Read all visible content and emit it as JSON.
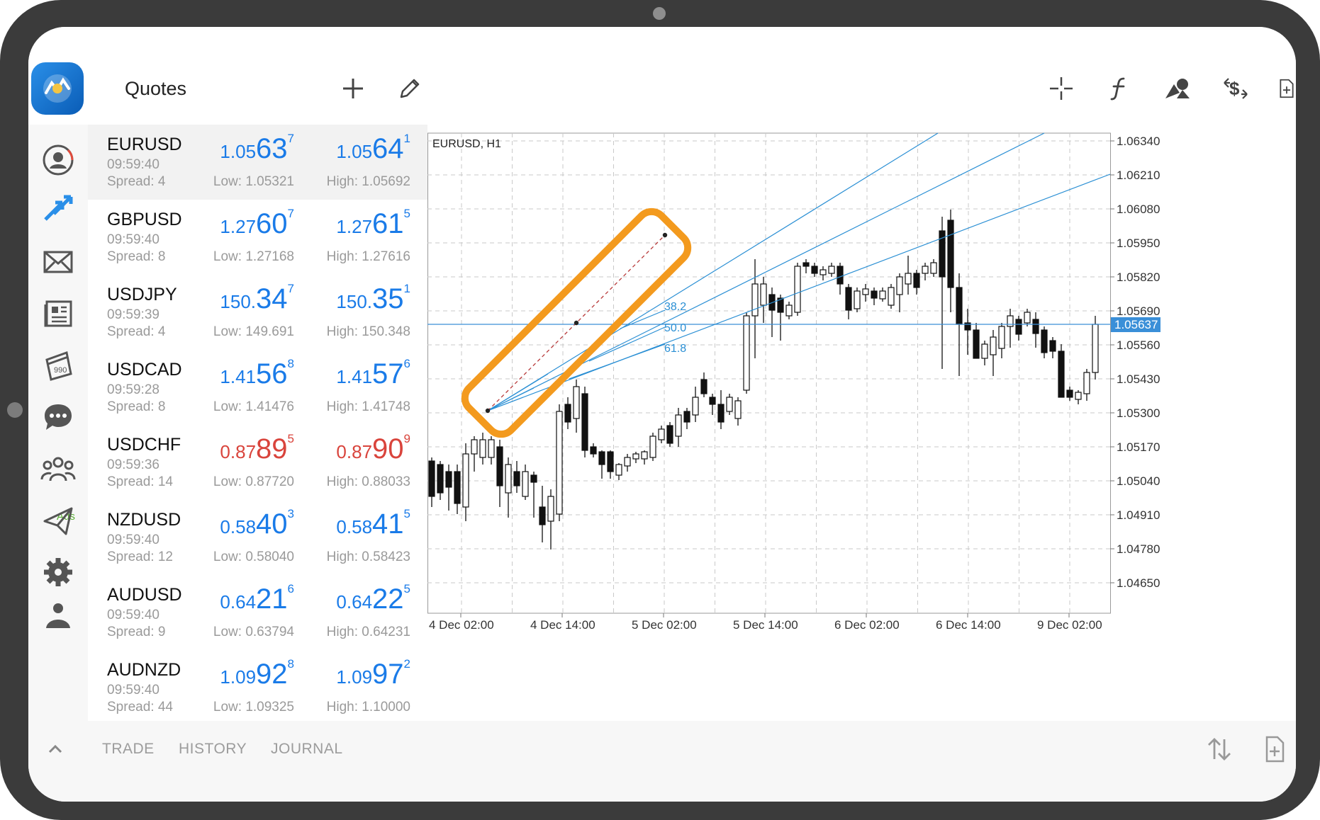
{
  "header": {
    "title": "Quotes",
    "icons": [
      "add-icon",
      "edit-icon",
      "crosshair-icon",
      "function-icon",
      "objects-icon",
      "trade-dollar-icon",
      "new-document-icon"
    ]
  },
  "sidebar": {
    "items": [
      "account",
      "trade",
      "mail",
      "news",
      "market-ads",
      "chat",
      "community",
      "telegram",
      "settings",
      "traders"
    ],
    "ads_label": "Ads"
  },
  "quotes": [
    {
      "symbol": "EURUSD",
      "time": "09:59:40",
      "spread": "Spread: 4",
      "bid": {
        "pre": "1.05",
        "big": "63",
        "sup": "7"
      },
      "ask": {
        "pre": "1.05",
        "big": "64",
        "sup": "1"
      },
      "low": "Low: 1.05321",
      "high": "High: 1.05692",
      "dir": "up"
    },
    {
      "symbol": "GBPUSD",
      "time": "09:59:40",
      "spread": "Spread: 8",
      "bid": {
        "pre": "1.27",
        "big": "60",
        "sup": "7"
      },
      "ask": {
        "pre": "1.27",
        "big": "61",
        "sup": "5"
      },
      "low": "Low: 1.27168",
      "high": "High: 1.27616",
      "dir": "up"
    },
    {
      "symbol": "USDJPY",
      "time": "09:59:39",
      "spread": "Spread: 4",
      "bid": {
        "pre": "150.",
        "big": "34",
        "sup": "7"
      },
      "ask": {
        "pre": "150.",
        "big": "35",
        "sup": "1"
      },
      "low": "Low: 149.691",
      "high": "High: 150.348",
      "dir": "up"
    },
    {
      "symbol": "USDCAD",
      "time": "09:59:28",
      "spread": "Spread: 8",
      "bid": {
        "pre": "1.41",
        "big": "56",
        "sup": "8"
      },
      "ask": {
        "pre": "1.41",
        "big": "57",
        "sup": "6"
      },
      "low": "Low: 1.41476",
      "high": "High: 1.41748",
      "dir": "up"
    },
    {
      "symbol": "USDCHF",
      "time": "09:59:36",
      "spread": "Spread: 14",
      "bid": {
        "pre": "0.87",
        "big": "89",
        "sup": "5"
      },
      "ask": {
        "pre": "0.87",
        "big": "90",
        "sup": "9"
      },
      "low": "Low: 0.87720",
      "high": "High: 0.88033",
      "dir": "down"
    },
    {
      "symbol": "NZDUSD",
      "time": "09:59:40",
      "spread": "Spread: 12",
      "bid": {
        "pre": "0.58",
        "big": "40",
        "sup": "3"
      },
      "ask": {
        "pre": "0.58",
        "big": "41",
        "sup": "5"
      },
      "low": "Low: 0.58040",
      "high": "High: 0.58423",
      "dir": "up"
    },
    {
      "symbol": "AUDUSD",
      "time": "09:59:40",
      "spread": "Spread: 9",
      "bid": {
        "pre": "0.64",
        "big": "21",
        "sup": "6"
      },
      "ask": {
        "pre": "0.64",
        "big": "22",
        "sup": "5"
      },
      "low": "Low: 0.63794",
      "high": "High: 0.64231",
      "dir": "up"
    },
    {
      "symbol": "AUDNZD",
      "time": "09:59:40",
      "spread": "Spread: 44",
      "bid": {
        "pre": "1.09",
        "big": "92",
        "sup": "8"
      },
      "ask": {
        "pre": "1.09",
        "big": "97",
        "sup": "2"
      },
      "low": "Low: 1.09325",
      "high": "High: 1.10000",
      "dir": "up"
    }
  ],
  "chart": {
    "label": "EURUSD, H1",
    "current_price": "1.05637",
    "price_labels": [
      "1.06340",
      "1.06210",
      "1.06080",
      "1.05950",
      "1.05820",
      "1.05690",
      "1.05560",
      "1.05430",
      "1.05300",
      "1.05170",
      "1.05040",
      "1.04910",
      "1.04780",
      "1.04650"
    ],
    "time_labels": [
      "4 Dec 02:00",
      "4 Dec 14:00",
      "5 Dec 02:00",
      "5 Dec 14:00",
      "6 Dec 02:00",
      "6 Dec 14:00",
      "9 Dec 02:00"
    ],
    "fib_labels": [
      "38.2",
      "50.0",
      "61.8"
    ],
    "colors": {
      "grid": "#c9c9c9",
      "line": "#2a8fd4",
      "highlight": "#f39a1e",
      "trend": "#b83a3a",
      "bid_line": "#3a8fd8"
    }
  },
  "tabs": {
    "trade": "TRADE",
    "history": "HISTORY",
    "journal": "JOURNAL"
  }
}
